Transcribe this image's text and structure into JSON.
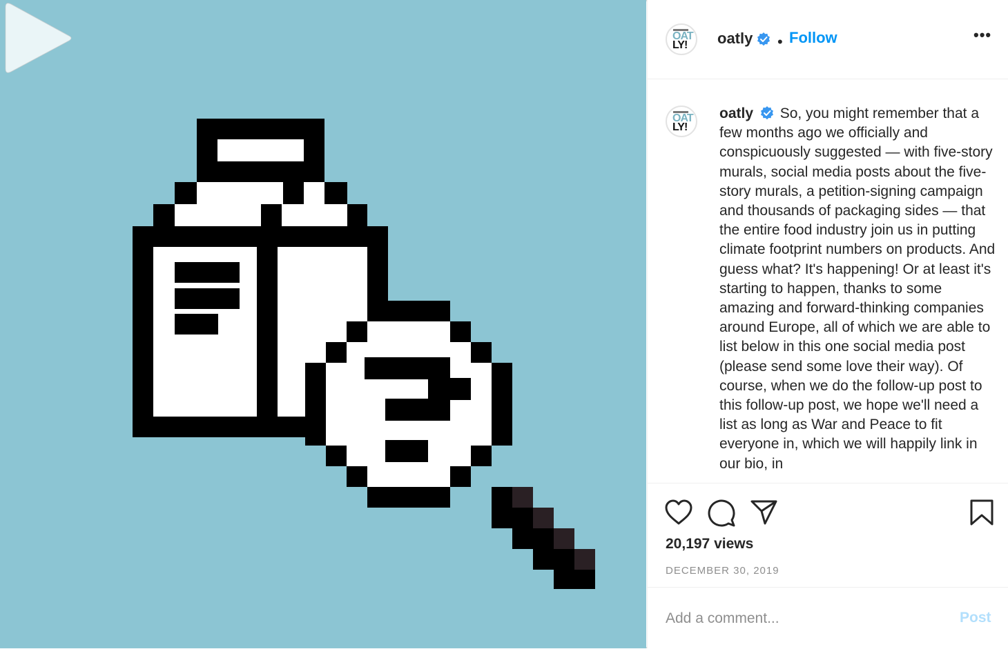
{
  "post": {
    "username": "oatly",
    "follow_label": "Follow",
    "separator": "•",
    "more_label": "•••",
    "caption_text": "So, you might remember that a few months ago we officially and conspicuously suggested — with five-story murals, social media posts about the five-story murals, a petition-signing campaign and thousands of packaging sides — that the entire food industry join us in putting climate footprint numbers on products. And guess what? It's happening! Or at least it's starting to happen, thanks to some amazing and forward-thinking companies around Europe, all of which we are able to list below in this one social media post (please send some love their way). Of course, when we do the follow-up post to this follow-up post, we hope we'll need a list as long as War and Peace to fit everyone in, which we will happily link in our bio, in",
    "views": "20,197 views",
    "date": "DECEMBER 30, 2019"
  },
  "avatar": {
    "logo_top": "OAT",
    "logo_bottom": "LY!"
  },
  "comment": {
    "placeholder": "Add a comment...",
    "post_label": "Post"
  },
  "icons": {
    "like": "heart-icon",
    "comment": "comment-bubble-icon",
    "share": "paper-plane-icon",
    "save": "bookmark-icon",
    "play": "play-icon",
    "verified": "verified-badge-icon",
    "more": "more-options-icon"
  },
  "colors": {
    "media_bg": "#8cc5d3",
    "link_blue": "#0095f6",
    "verified_blue": "#3897f0",
    "post_disabled": "#b2dffc"
  }
}
